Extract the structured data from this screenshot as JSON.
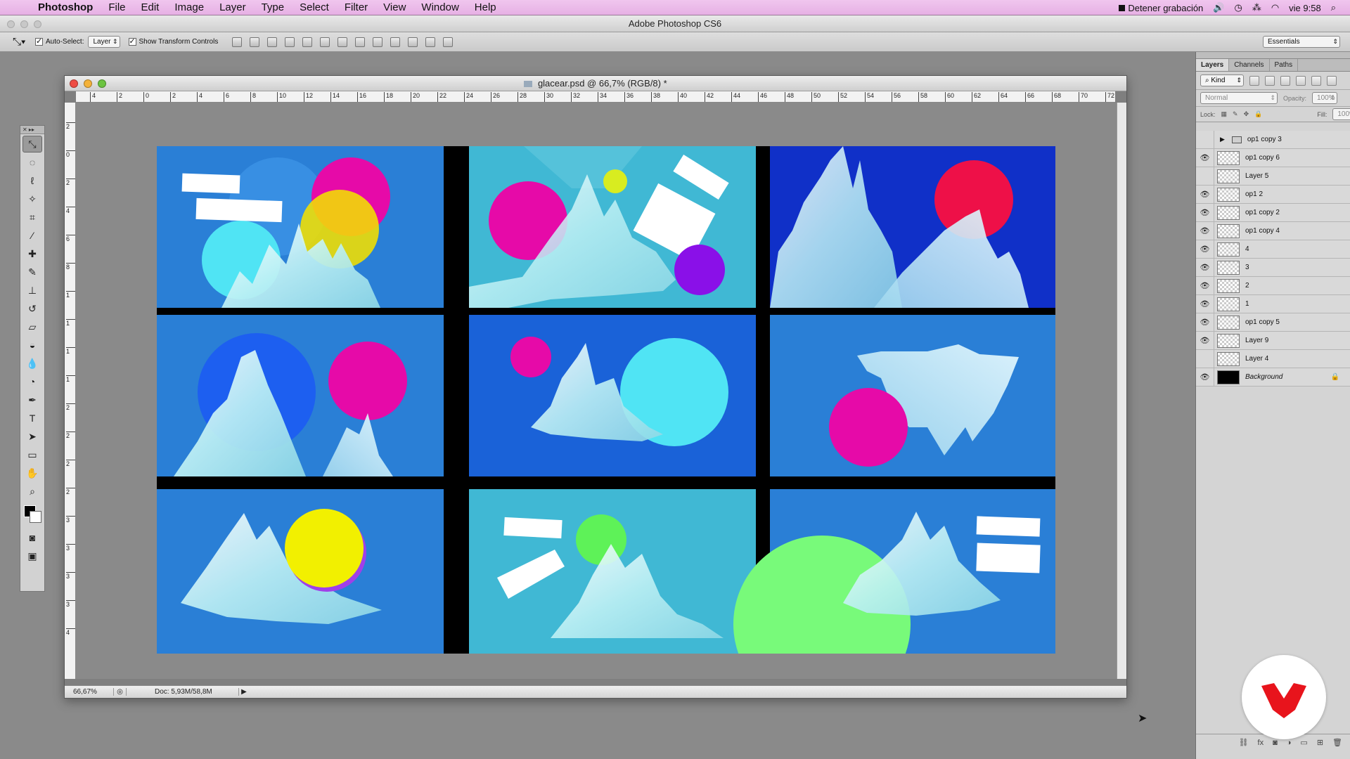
{
  "menubar": {
    "app": "Photoshop",
    "menus": [
      "File",
      "Edit",
      "Image",
      "Layer",
      "Type",
      "Select",
      "Filter",
      "View",
      "Window",
      "Help"
    ],
    "recording": "Detener grabación",
    "clock": "vie 9:58"
  },
  "window_title": "Adobe Photoshop CS6",
  "options": {
    "auto_select_label": "Auto-Select:",
    "auto_select_value": "Layer",
    "show_transform_label": "Show Transform Controls",
    "workspace": "Essentials"
  },
  "document": {
    "title": "glacear.psd @ 66,7% (RGB/8) *",
    "zoom": "66,67%",
    "doc_size": "Doc: 5,93M/58,8M",
    "hruler": [
      "4",
      "2",
      "0",
      "2",
      "4",
      "6",
      "8",
      "10",
      "12",
      "14",
      "16",
      "18",
      "20",
      "22",
      "24",
      "26",
      "28",
      "30",
      "32",
      "34",
      "36",
      "38",
      "40",
      "42",
      "44",
      "46",
      "48",
      "50",
      "52",
      "54",
      "56",
      "58",
      "60",
      "62",
      "64",
      "66",
      "68",
      "70",
      "72"
    ],
    "vruler": [
      "2",
      "0",
      "2",
      "4",
      "6",
      "8",
      "1",
      "1",
      "1",
      "1",
      "2",
      "2",
      "2",
      "2",
      "3",
      "3",
      "3",
      "3",
      "4"
    ]
  },
  "artboard": {
    "colors": {
      "blue": "#2a7fd6",
      "deep_blue": "#1030c8",
      "teal": "#40b8d4",
      "magenta": "#e60aa8",
      "yellow": "#f2e000",
      "cyan": "#50e4f4",
      "red": "#ee1048",
      "purple": "#8a10e8",
      "green": "#5ef258",
      "lime": "#d8ec20",
      "lightgreen": "#78fa7a"
    }
  },
  "layers_panel": {
    "tabs": [
      "Layers",
      "Channels",
      "Paths"
    ],
    "filter": "Kind",
    "blend": "Normal",
    "opacity_label": "Opacity:",
    "opacity": "100%",
    "lock_label": "Lock:",
    "fill_label": "Fill:",
    "fill": "100%",
    "layers": [
      {
        "name": "op1 copy 3",
        "visible": false,
        "group": true
      },
      {
        "name": "op1 copy 6",
        "visible": true
      },
      {
        "name": "Layer 5",
        "visible": false
      },
      {
        "name": "op1 2",
        "visible": true
      },
      {
        "name": "op1 copy 2",
        "visible": true
      },
      {
        "name": "op1 copy 4",
        "visible": true
      },
      {
        "name": "4",
        "visible": true
      },
      {
        "name": "3",
        "visible": true
      },
      {
        "name": "2",
        "visible": true
      },
      {
        "name": "1",
        "visible": true
      },
      {
        "name": "op1 copy 5",
        "visible": true
      },
      {
        "name": "Layer 9",
        "visible": true
      },
      {
        "name": "Layer 4",
        "visible": false
      },
      {
        "name": "Background",
        "visible": true,
        "background": true
      }
    ]
  },
  "icons": {
    "eye": "eye-icon",
    "lock": "lock-icon",
    "apple": "apple-icon"
  }
}
